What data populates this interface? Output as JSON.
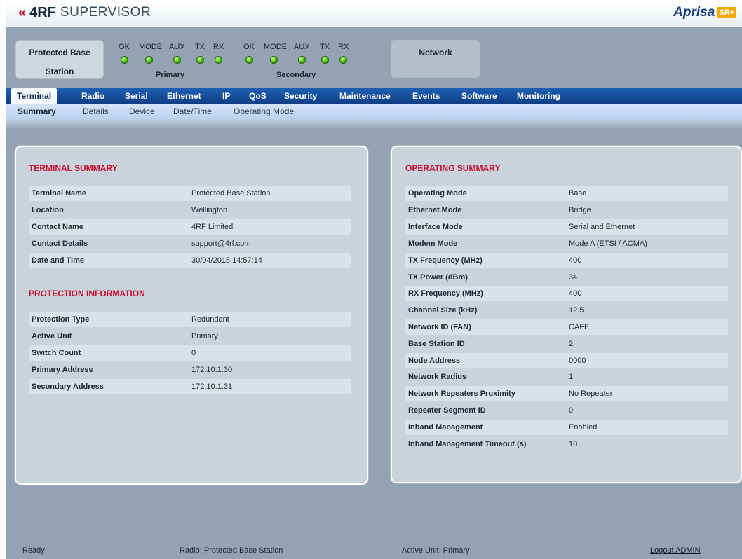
{
  "header": {
    "logo_mark": "«",
    "logo_brand": "4RF",
    "logo_product": "SUPERVISOR",
    "aprisa_word": "Aprisa",
    "aprisa_badge": "SR+"
  },
  "status": {
    "unit_name_line1": "Protected Base",
    "unit_name_line2": "Station",
    "network_label": "Network",
    "primary": {
      "label": "Primary",
      "leds": [
        {
          "label": "OK",
          "state": "green"
        },
        {
          "label": "MODE",
          "state": "green"
        },
        {
          "label": "AUX",
          "state": "green"
        },
        {
          "label": "TX",
          "state": "green"
        },
        {
          "label": "RX",
          "state": "green"
        }
      ]
    },
    "secondary": {
      "label": "Secondary",
      "leds": [
        {
          "label": "OK",
          "state": "green"
        },
        {
          "label": "MODE",
          "state": "green"
        },
        {
          "label": "AUX",
          "state": "green"
        },
        {
          "label": "TX",
          "state": "green"
        },
        {
          "label": "RX",
          "state": "green"
        }
      ]
    }
  },
  "nav": {
    "tabs": [
      "Terminal",
      "Radio",
      "Serial",
      "Ethernet",
      "IP",
      "QoS",
      "Security",
      "Maintenance",
      "Events",
      "Software",
      "Monitoring"
    ],
    "active_tab": "Terminal",
    "subtabs": [
      "Summary",
      "Details",
      "Device",
      "Date/Time",
      "Operating Mode"
    ],
    "active_subtab": "Summary"
  },
  "terminal_summary": {
    "title": "TERMINAL SUMMARY",
    "rows": [
      {
        "key": "Terminal Name",
        "value": "Protected Base Station"
      },
      {
        "key": "Location",
        "value": "Wellington"
      },
      {
        "key": "Contact Name",
        "value": "4RF Limited"
      },
      {
        "key": "Contact Details",
        "value": "support@4rf.com"
      },
      {
        "key": "Date and Time",
        "value": "30/04/2015 14:57:14"
      }
    ]
  },
  "protection_information": {
    "title": "PROTECTION INFORMATION",
    "rows": [
      {
        "key": "Protection Type",
        "value": "Redundant"
      },
      {
        "key": "Active Unit",
        "value": "Primary"
      },
      {
        "key": "Switch Count",
        "value": "0"
      },
      {
        "key": "Primary Address",
        "value": "172.10.1.30"
      },
      {
        "key": "Secondary Address",
        "value": "172.10.1.31"
      }
    ]
  },
  "operating_summary": {
    "title": "OPERATING SUMMARY",
    "rows": [
      {
        "key": "Operating Mode",
        "value": "Base"
      },
      {
        "key": "Ethernet Mode",
        "value": "Bridge"
      },
      {
        "key": "Interface Mode",
        "value": "Serial and Ethernet"
      },
      {
        "key": "Modem Mode",
        "value": "Mode A (ETSI / ACMA)"
      },
      {
        "key": "TX Frequency (MHz)",
        "value": "400"
      },
      {
        "key": "TX Power (dBm)",
        "value": "34"
      },
      {
        "key": "RX Frequency (MHz)",
        "value": "400"
      },
      {
        "key": "Channel Size (kHz)",
        "value": "12.5"
      },
      {
        "key": "Network ID (FAN)",
        "value": "CAFE"
      },
      {
        "key": "Base Station ID",
        "value": "2"
      },
      {
        "key": "Node Address",
        "value": "0000"
      },
      {
        "key": "Network Radius",
        "value": "1"
      },
      {
        "key": "Network Repeaters Proximity",
        "value": "No Repeater"
      },
      {
        "key": "Repeater Segment ID",
        "value": "0"
      },
      {
        "key": "Inband Management",
        "value": "Enabled"
      },
      {
        "key": "Inband Management Timeout (s)",
        "value": "10"
      }
    ]
  },
  "statusbar": {
    "state": "Ready",
    "radio": "Radio: Protected Base Station",
    "active_unit": "Active Unit: Primary",
    "logout": "Logout ADMIN"
  },
  "colors": {
    "frame_bg": "#93a3b1",
    "nav_blue": "#1d5fb2",
    "section_red": "#c8102e",
    "led_green": "#35b800"
  }
}
